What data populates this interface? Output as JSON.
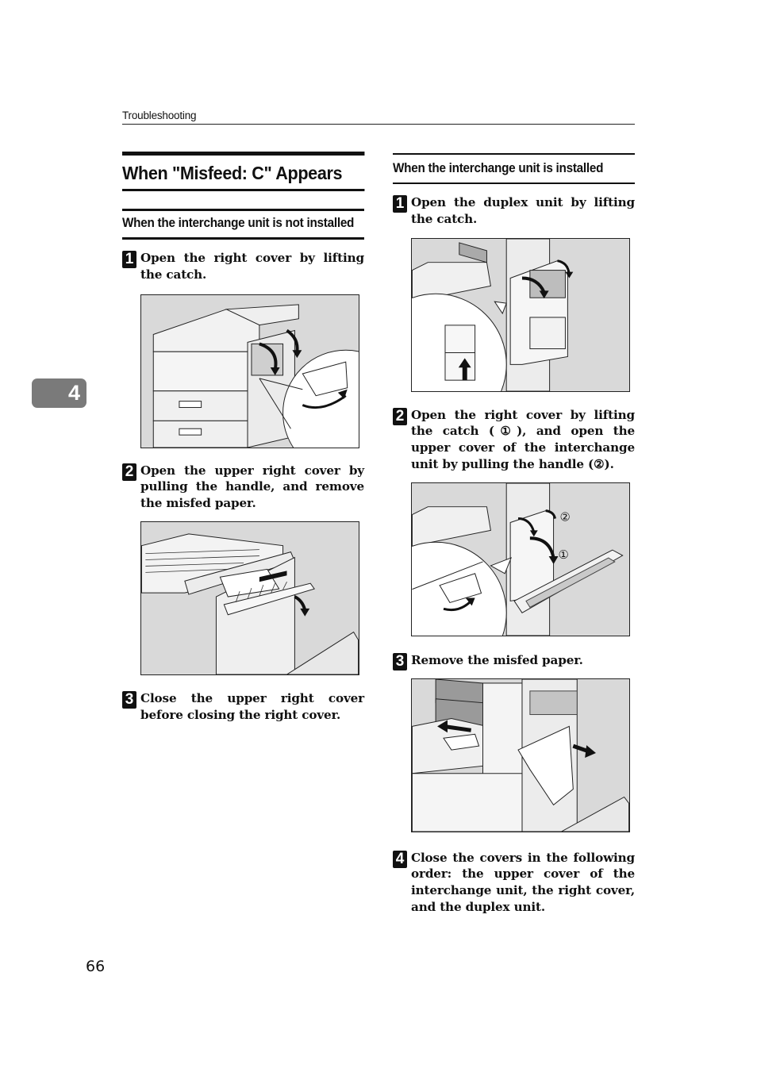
{
  "running_head": "Troubleshooting",
  "chapter_tab": "4",
  "page_number": "66",
  "page_title": "When \"Misfeed: C\" Appears",
  "sections": [
    {
      "heading": "When the interchange unit is not installed",
      "steps": [
        {
          "number": "1",
          "text": "Open the right cover by lifting the catch.",
          "figure": "printer-right-cover-opening-with-catch-detail"
        },
        {
          "number": "2",
          "text": "Open the upper right cover by pulling the handle, and remove the misfed paper.",
          "figure": "upper-right-cover-open-removing-misfed-paper"
        },
        {
          "number": "3",
          "text": "Close the upper right cover before closing the right cover."
        }
      ]
    },
    {
      "heading": "When the interchange unit is installed",
      "steps": [
        {
          "number": "1",
          "text": "Open the duplex unit by lifting the catch.",
          "figure": "duplex-unit-opening-with-catch-detail"
        },
        {
          "number": "2",
          "text": "Open the right cover by lifting the catch (①), and open the upper cover of the interchange unit by pulling the handle (②).",
          "figure": "right-cover-and-interchange-upper-cover-opening",
          "callouts": [
            "②",
            "①"
          ]
        },
        {
          "number": "3",
          "text": "Remove the misfed paper.",
          "figure": "removing-misfed-paper-from-interchange-unit"
        },
        {
          "number": "4",
          "text": "Close the covers in the following order: the upper cover of the interchange unit, the right cover, and the duplex unit."
        }
      ]
    }
  ]
}
